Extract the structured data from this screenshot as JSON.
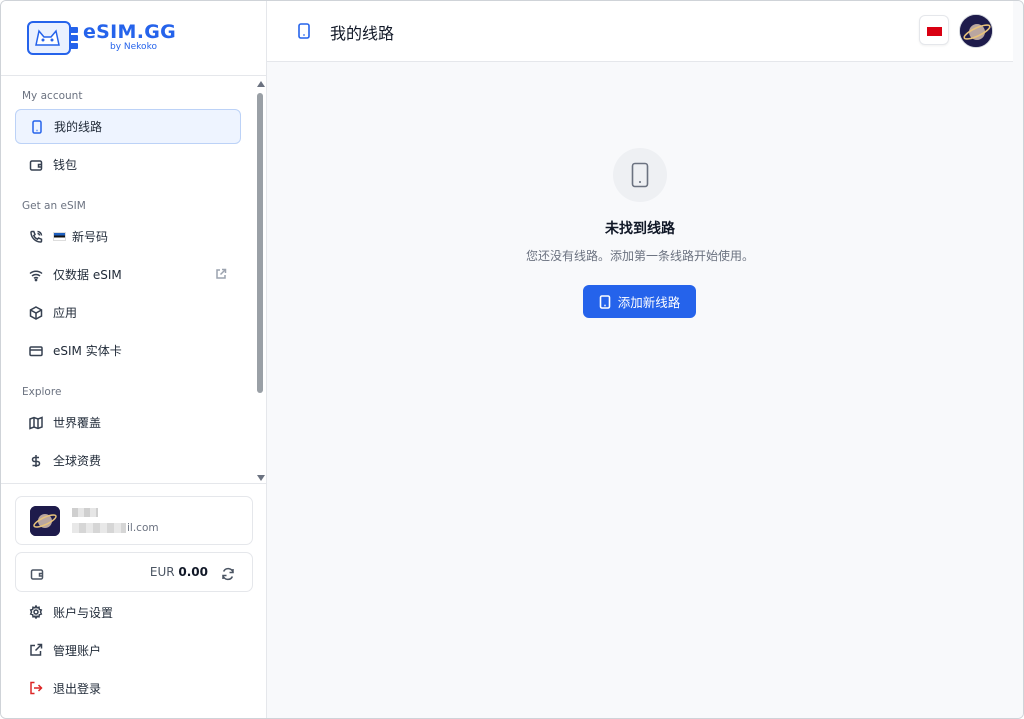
{
  "brand": {
    "name": "eSIM.GG",
    "sub": "by Nekoko"
  },
  "sidebar": {
    "sections": {
      "account": "My account",
      "get": "Get an eSIM",
      "explore": "Explore"
    },
    "items": [
      {
        "label": "我的线路",
        "icon": "phone-icon",
        "active": true
      },
      {
        "label": "钱包",
        "icon": "wallet-icon"
      },
      {
        "label": "新号码",
        "icon": "phone-call-icon",
        "flag": "EE"
      },
      {
        "label": "仅数据 eSIM",
        "icon": "wifi-icon",
        "external": true
      },
      {
        "label": "应用",
        "icon": "package-icon"
      },
      {
        "label": "eSIM 实体卡",
        "icon": "card-icon"
      },
      {
        "label": "世界覆盖",
        "icon": "map-icon"
      },
      {
        "label": "全球资费",
        "icon": "dollar-icon"
      }
    ]
  },
  "account": {
    "email_tail": "il.com"
  },
  "wallet": {
    "currency": "EUR",
    "amount": "0.00"
  },
  "bottom_links": [
    {
      "label": "账户与设置",
      "icon": "gear-icon"
    },
    {
      "label": "管理账户",
      "icon": "external-link-icon"
    },
    {
      "label": "退出登录",
      "icon": "logout-icon"
    }
  ],
  "header": {
    "title": "我的线路"
  },
  "empty_state": {
    "title": "未找到线路",
    "description": "您还没有线路。添加第一条线路开始使用。",
    "button": "添加新线路"
  },
  "colors": {
    "accent": "#2563eb",
    "active_bg": "#eef4ff",
    "logout": "#dc2626"
  }
}
